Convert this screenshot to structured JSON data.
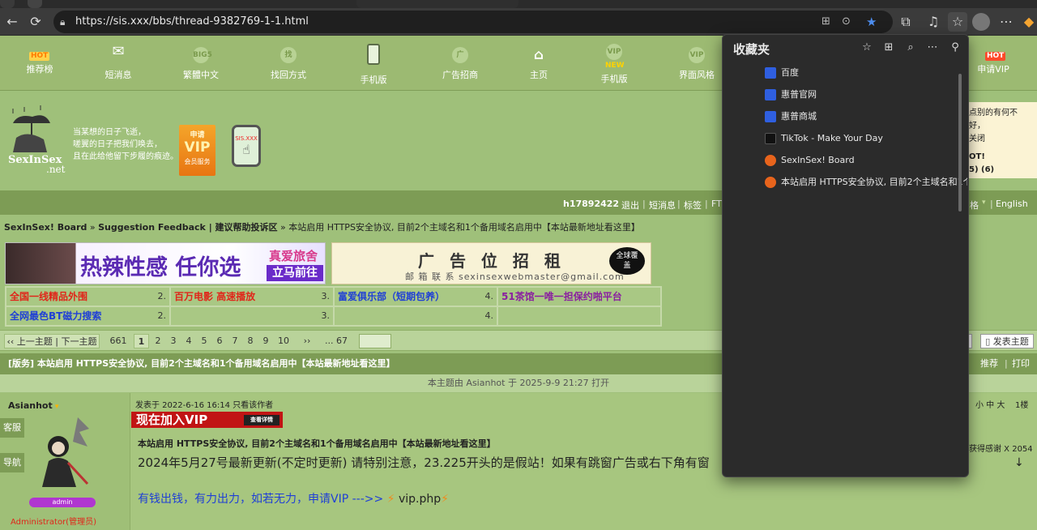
{
  "browser": {
    "url": "https://sis.xxx/bbs/thread-9382769-1-1.html",
    "url_prefix": "https://",
    "url_rest": "sis.xxx/bbs/thread-9382769-1-1.html"
  },
  "topnav": [
    {
      "label": "推荐榜",
      "badge": "HOT"
    },
    {
      "label": "短消息"
    },
    {
      "label": "繁體中文",
      "badge_icon": "BIG5"
    },
    {
      "label": "找回方式",
      "badge_icon": "找"
    },
    {
      "label": "手机版"
    },
    {
      "label": "广告招商",
      "badge_icon": "广"
    },
    {
      "label": "主页"
    },
    {
      "label": "手机版",
      "badge": "NEW",
      "badge_icon": "VIP"
    },
    {
      "label": "界面风格",
      "badge_icon": "VIP"
    },
    {
      "label": "申请VIP",
      "badge": "HOT"
    }
  ],
  "logo": {
    "text": "SexInSex",
    "net": ".net"
  },
  "poem": "当某想的日子飞逝，\n嗟翼的日子把我们唤去，\n且在此给他留下步履的痕迹。",
  "vip_badge": {
    "top": "申请",
    "mid": "VIP",
    "bottom": "会员服务"
  },
  "phone_badge": "SIS.XXX",
  "userbar": {
    "username": "h17892422",
    "links": [
      "退出",
      "短消息",
      "标签",
      "FTI"
    ],
    "right": [
      "格",
      "English"
    ]
  },
  "breadcrumb": {
    "board": "SexInSex! Board",
    "sep": " » ",
    "forum": "Suggestion Feedback | 建议帮助投诉区",
    "thread": "本站启用 HTTPS安全协议, 目前2个主域名和1个备用域名启用中【本站最新地址看这里】"
  },
  "ads": {
    "left_main": "热辣性感 任你选",
    "left_tag": "真爱旅舍",
    "left_sub": "立马前往",
    "right_title": "广 告 位 招 租",
    "right_contact": "邮 箱 联 系   sexinsexwebmaster@gmail.com",
    "right_badge": "全球覆盖"
  },
  "links": [
    {
      "text": "全国一线精品外围",
      "n": "2.",
      "color": "#e0261a"
    },
    {
      "text": "百万电影 高速播放",
      "n": "3.",
      "color": "#e0261a"
    },
    {
      "text": "富爱俱乐部（短期包养）",
      "n": "4.",
      "color": "#1f3fd6"
    },
    {
      "text": "51茶馆一唯一担保约啪平台",
      "n": "",
      "color": "#8a1fa0"
    },
    {
      "text": "全网最色BT磁力搜索",
      "n": "2.",
      "color": "#1f3fd6"
    },
    {
      "text": "",
      "n": "3.",
      "color": "#333"
    },
    {
      "text": "",
      "n": "4.",
      "color": "#333"
    },
    {
      "text": "",
      "n": "",
      "color": "#333"
    }
  ],
  "pager": {
    "prevnext": "‹‹ 上一主题 | 下一主题 ››",
    "total": "661",
    "pages": [
      "1",
      "2",
      "3",
      "4",
      "5",
      "6",
      "7",
      "8",
      "9",
      "10"
    ],
    "next": "››",
    "last": "... 67",
    "new_topic": "发表主题"
  },
  "thread_title": "[版务] 本站启用 HTTPS安全协议, 目前2个主域名和1个备用域名启用中【本站最新地址看这里】",
  "thread_actions": [
    "推荐",
    "打印"
  ],
  "opened_by": "本主题由 Asianhot 于 2025-9-9 21:27 打开",
  "post": {
    "author": "Asianhot",
    "role": "Administrator(管理员)",
    "rank_badge": "admin",
    "side_buttons": [
      "客服",
      "导航"
    ],
    "meta": "发表于 2022-6-16 16:14  只看该作者",
    "font_sizes": "小 中 大",
    "floor": "1楼",
    "vip_banner": "现在加入VIP",
    "vip_banner_small": "查看详情",
    "title": "本站启用 HTTPS安全协议, 目前2个主域名和1个备用域名启用中【本站最新地址看这里】",
    "line1": "2024年5月27号最新更新(不定时更新) 请特别注意，23.225开头的是假站！如果有跳窗广告或右下角有窗",
    "line2": "有钱出钱，有力出力，如若无力，申请VIP --->>",
    "line2_link": "vip.php",
    "thanks": "获得感谢 X 2054"
  },
  "right_notice": [
    "点别的有何不好，",
    "关闭",
    "OT!",
    "5) (6)"
  ],
  "favorites": {
    "title": "收藏夹",
    "items": [
      {
        "label": "百度",
        "icon": "baidu-icon",
        "color": "#2f5fe0"
      },
      {
        "label": "惠普官网",
        "icon": "baidu-icon",
        "color": "#2f5fe0"
      },
      {
        "label": "惠普商城",
        "icon": "baidu-icon",
        "color": "#2f5fe0"
      },
      {
        "label": "TikTok - Make Your Day",
        "icon": "tiktok-icon",
        "color": "#111111"
      },
      {
        "label": "SexInSex! Board",
        "icon": "sis-icon",
        "color": "#e8641c"
      },
      {
        "label": "本站启用 HTTPS安全协议, 目前2个主域名和1个",
        "icon": "sis-icon",
        "color": "#e8641c"
      }
    ]
  }
}
